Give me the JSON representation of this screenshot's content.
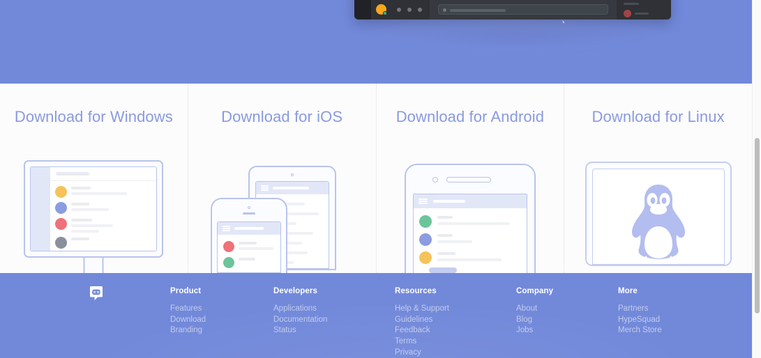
{
  "page": {
    "brand_color": "#7289da",
    "card_bg": "#fcfcfd",
    "heading_color": "#8a9ae0",
    "footer_link_color": "#c3cbec"
  },
  "hero": {
    "name": "hero-banner",
    "background_color": "#7289da",
    "mockup": {
      "name": "app-window-mockup",
      "background_color": "#36393f",
      "sidebar_color": "#202225",
      "channel_panel_color": "#2f3136",
      "avatar_color": "#faa61a",
      "status_color": "#43b581",
      "member_avatar_color": "#a04545"
    }
  },
  "downloads": {
    "cards": [
      {
        "id": "windows",
        "title": "Download for Windows",
        "illustration": "desktop-monitor-illustration",
        "avatar_colors": [
          "#f6c35a",
          "#8b9ce0",
          "#ef7179",
          "#8a8f9e"
        ]
      },
      {
        "id": "ios",
        "title": "Download for iOS",
        "illustration": "tablet-and-phone-illustration",
        "avatar_colors": [
          "#ef7179",
          "#6cc49a"
        ]
      },
      {
        "id": "android",
        "title": "Download for Android",
        "illustration": "android-phone-illustration",
        "avatar_colors": [
          "#6cc49a",
          "#8b9ce0",
          "#f6c35a"
        ]
      },
      {
        "id": "linux",
        "title": "Download for Linux",
        "illustration": "linux-penguin-illustration",
        "penguin_color": "#b3bdef"
      }
    ]
  },
  "footer": {
    "logo": "discord-logo-icon",
    "background_color": "#7289da",
    "columns": [
      {
        "title": "Product",
        "links": [
          "Features",
          "Download",
          "Branding"
        ]
      },
      {
        "title": "Developers",
        "links": [
          "Applications",
          "Documentation",
          "Status"
        ]
      },
      {
        "title": "Resources",
        "links": [
          "Help & Support",
          "Guidelines",
          "Feedback",
          "Terms",
          "Privacy"
        ]
      },
      {
        "title": "Company",
        "links": [
          "About",
          "Blog",
          "Jobs"
        ]
      },
      {
        "title": "More",
        "links": [
          "Partners",
          "HypeSquad",
          "Merch Store"
        ]
      }
    ]
  },
  "scrollbar": {
    "name": "vertical-scrollbar",
    "thumb_color": "#bdbdbd"
  }
}
